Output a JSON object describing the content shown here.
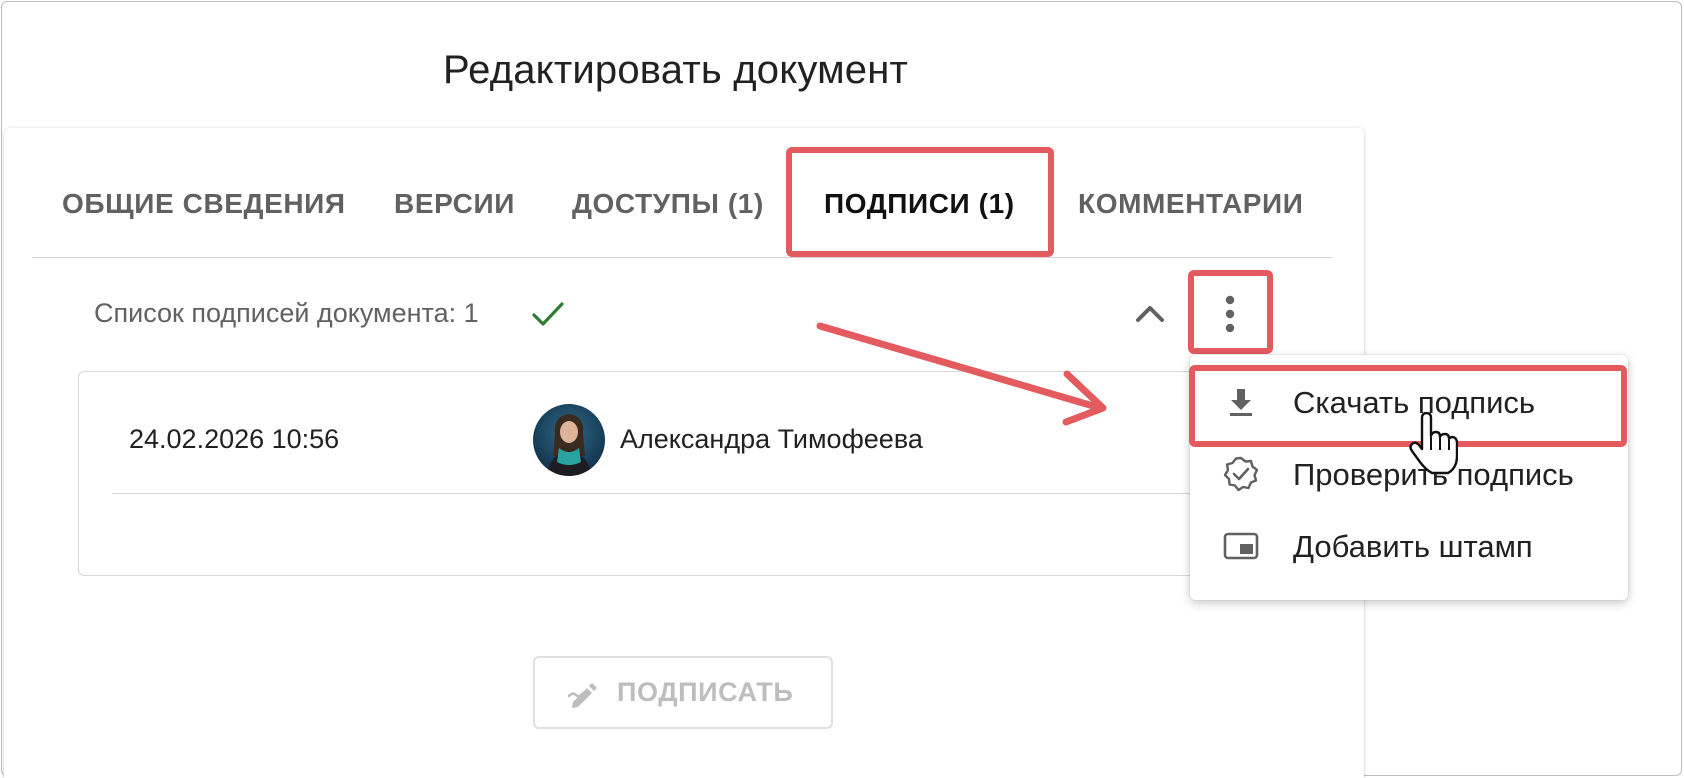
{
  "page": {
    "title": "Редактировать документ"
  },
  "tabs": [
    {
      "label": "ОБЩИЕ СВЕДЕНИЯ"
    },
    {
      "label": "ВЕРСИИ"
    },
    {
      "label": "ДОСТУПЫ (1)"
    },
    {
      "label": "ПОДПИСИ (1)",
      "active": true
    },
    {
      "label": "КОММЕНТАРИИ"
    }
  ],
  "signatures": {
    "header": "Список подписей документа: 1",
    "status_icon": "check-icon",
    "rows": [
      {
        "date": "24.02.2026 10:56",
        "name": "Александра Тимофеева",
        "avatar": "avatar-photo"
      }
    ]
  },
  "menu": {
    "items": [
      {
        "label": "Скачать подпись",
        "icon": "download-icon"
      },
      {
        "label": "Проверить подпись",
        "icon": "verified-badge-icon"
      },
      {
        "label": "Добавить штамп",
        "icon": "stamp-icon"
      }
    ]
  },
  "sign_button": {
    "label": "ПОДПИСАТЬ",
    "icon": "sign-pen-icon",
    "disabled": true
  },
  "colors": {
    "highlight": "#e35a5f",
    "check": "#2e7d32",
    "tab_text": "#616161",
    "tab_active": "#111111",
    "disabled": "#bdbdbd"
  }
}
